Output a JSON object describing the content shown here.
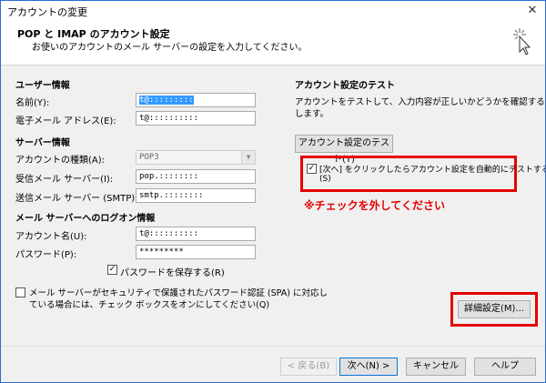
{
  "window": {
    "title": "アカウントの変更",
    "close_glyph": "✕"
  },
  "header": {
    "title": "POP と IMAP のアカウント設定",
    "subtitle": "お使いのアカウントのメール サーバーの設定を入力してください。"
  },
  "user_info": {
    "heading": "ユーザー情報",
    "name_label": "名前(Y):",
    "name_value": "t@:::::::::",
    "email_label": "電子メール アドレス(E):",
    "email_value": "t@::::::::::"
  },
  "server_info": {
    "heading": "サーバー情報",
    "account_type_label": "アカウントの種類(A):",
    "account_type_value": "POP3",
    "incoming_label": "受信メール サーバー(I):",
    "incoming_value": "pop.::::::::",
    "outgoing_label": "送信メール サーバー (SMTP)(O):",
    "outgoing_value": "smtp.::::::::"
  },
  "logon_info": {
    "heading": "メール サーバーへのログオン情報",
    "account_label": "アカウント名(U):",
    "account_value": "t@::::::::::",
    "password_label": "パスワード(P):",
    "password_value": "*********",
    "remember_label": "パスワードを保存する(R)",
    "remember_checked": "✓"
  },
  "spa": {
    "line1": "メール サーバーがセキュリティで保護されたパスワード認証 (SPA) に対応し",
    "line2": "ている場合には、チェック ボックスをオンにしてください(Q)"
  },
  "test": {
    "heading": "アカウント設定のテスト",
    "desc1": "アカウントをテストして、入力内容が正しいかどうかを確認することをお勧め",
    "desc2": "します。",
    "test_button": "アカウント設定のテスト(T)",
    "auto_test_line1": "[次へ] をクリックしたらアカウント設定を自動的にテストする",
    "auto_test_line2": "(S)",
    "auto_test_checked": "✓",
    "warning": "※チェックを外してください"
  },
  "buttons": {
    "more_settings": "詳細設定(M)...",
    "back": "< 戻る(B)",
    "next": "次へ(N) >",
    "cancel": "キャンセル",
    "help": "ヘルプ"
  },
  "colors": {
    "highlight": "#e60000",
    "accent": "#0078d7"
  }
}
